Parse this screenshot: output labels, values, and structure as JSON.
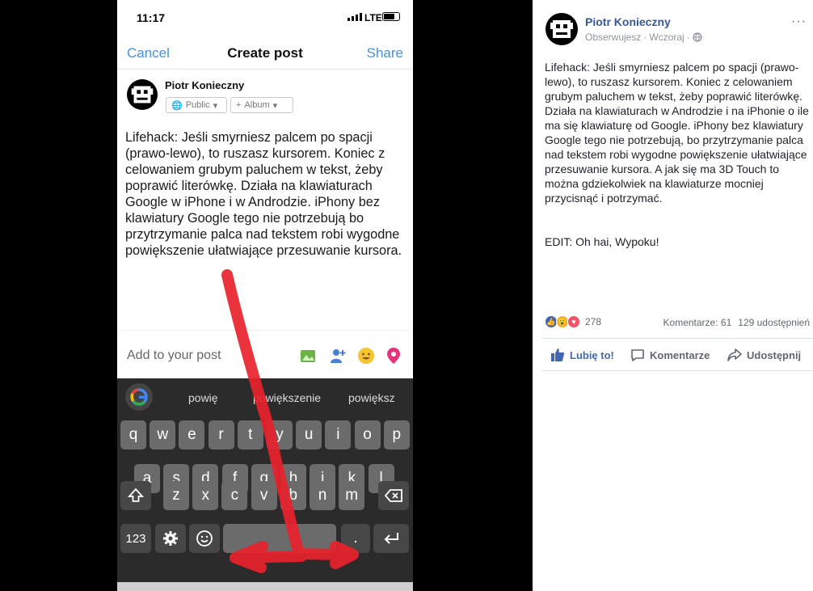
{
  "phone": {
    "status": {
      "time": "11:17",
      "network": "LTE"
    },
    "nav": {
      "cancel": "Cancel",
      "title": "Create post",
      "share": "Share"
    },
    "composer": {
      "author": "Piotr Konieczny",
      "audience": "Public",
      "album": "Album",
      "text": "Lifehack: Jeśli smyrniesz palcem po spacji (prawo-lewo), to ruszasz kursorem. Koniec z celowaniem grubym paluchem w tekst, żeby poprawić literówkę. Działa na klawiaturach Google w iPhone i w Androdzie. iPhony bez klawiatury Google tego nie potrzebują bo przytrzymanie palca nad tekstem robi wygodne powiększenie ułatwiające przesuwanie kursora."
    },
    "add_to_post": {
      "label": "Add to your post",
      "icons": [
        "photo-icon",
        "tag-people-icon",
        "feeling-icon",
        "location-icon"
      ]
    },
    "keyboard": {
      "suggestions": [
        "powię",
        "powiększenie",
        "powiększ"
      ],
      "row1": [
        "q",
        "w",
        "e",
        "r",
        "t",
        "y",
        "u",
        "i",
        "o",
        "p"
      ],
      "row2": [
        "a",
        "s",
        "d",
        "f",
        "g",
        "h",
        "j",
        "k",
        "l"
      ],
      "row3": [
        "z",
        "x",
        "c",
        "v",
        "b",
        "n",
        "m"
      ],
      "numbers_key": "123",
      "period_key": ".",
      "shift_icon": "shift-icon",
      "backspace_icon": "backspace-icon",
      "settings_icon": "gear-icon",
      "emoji_icon": "emoji-icon",
      "return_icon": "return-icon"
    },
    "annotation": {
      "color": "#e8222b"
    }
  },
  "post": {
    "author": "Piotr Konieczny",
    "follow_status": "Obserwujesz",
    "time": "Wczoraj",
    "privacy_icon": "globe-icon",
    "body": "Lifehack: Jeśli smyrniesz palcem po spacji (prawo-lewo), to ruszasz kursorem. Koniec z celowaniem grubym paluchem w tekst, żeby poprawić literówkę. Działa na klawiaturach w Androdzie i na iPhonie o ile ma się klawiaturę od Google. iPhony bez klawiatury Google tego nie potrzebują, bo przytrzymanie palca nad tekstem robi wygodne powiększenie ułatwiające przesuwanie kursora. A jak się ma 3D Touch to można gdziekolwiek na klawiaturze mocniej przycisnąć i potrzymać.",
    "edit": "EDIT: Oh hai, Wypoku!",
    "reactions": {
      "count": "278",
      "types": [
        "like",
        "wow",
        "love"
      ]
    },
    "comments": "Komentarze: 61",
    "shares": "129 udostępnień",
    "actions": {
      "like": "Lubię to!",
      "comment": "Komentarze",
      "share": "Udostępnij"
    },
    "colors": {
      "link": "#365899",
      "like_blue": "#4267b2",
      "love_red": "#f25268",
      "wow_yellow": "#f7b125"
    }
  }
}
